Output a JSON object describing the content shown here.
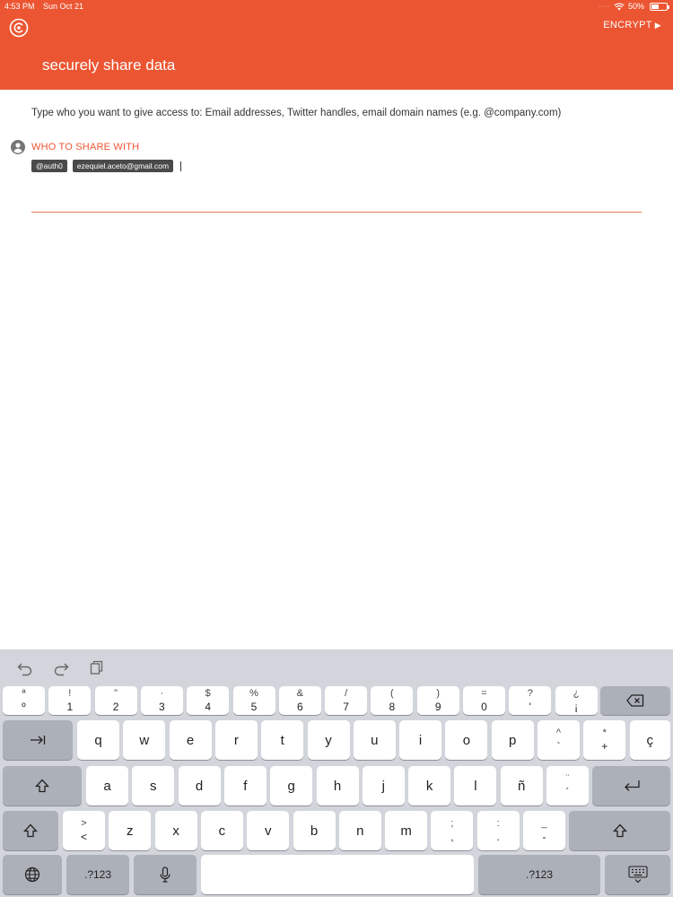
{
  "status_bar": {
    "time": "4:53 PM",
    "date": "Sun Oct 21",
    "battery": "50%",
    "battery_level": 0.5
  },
  "header": {
    "title": "securely share data",
    "encrypt_label": "ENCRYPT",
    "encrypt_arrow": "▶",
    "accent_color": "#ec5532"
  },
  "content": {
    "instructions": "Type who you want to give access to: Email addresses, Twitter handles, email domain names (e.g. @company.com)",
    "field_label": "WHO TO SHARE WITH",
    "chips": [
      "@auth0",
      "ezequiel.aceto@gmail.com"
    ]
  },
  "keyboard": {
    "row1": [
      {
        "top": "ª",
        "bottom": "º"
      },
      {
        "top": "!",
        "bottom": "1"
      },
      {
        "top": "\"",
        "bottom": "2"
      },
      {
        "top": "·",
        "bottom": "3"
      },
      {
        "top": "$",
        "bottom": "4"
      },
      {
        "top": "%",
        "bottom": "5"
      },
      {
        "top": "&",
        "bottom": "6"
      },
      {
        "top": "/",
        "bottom": "7"
      },
      {
        "top": "(",
        "bottom": "8"
      },
      {
        "top": ")",
        "bottom": "9"
      },
      {
        "top": "=",
        "bottom": "0"
      },
      {
        "top": "?",
        "bottom": "'"
      },
      {
        "top": "¿",
        "bottom": "¡"
      }
    ],
    "row2": [
      "q",
      "w",
      "e",
      "r",
      "t",
      "y",
      "u",
      "i",
      "o",
      "p"
    ],
    "row2_extra": [
      {
        "top": "^",
        "bottom": "`"
      },
      {
        "top": "*",
        "bottom": "+"
      },
      {
        "top": "",
        "bottom": "ç"
      }
    ],
    "row3": [
      "a",
      "s",
      "d",
      "f",
      "g",
      "h",
      "j",
      "k",
      "l",
      "ñ"
    ],
    "row3_extra": {
      "top": "¨",
      "bottom": "´"
    },
    "row4_extra_left": {
      "top": ">",
      "bottom": "<"
    },
    "row4": [
      "z",
      "x",
      "c",
      "v",
      "b",
      "n",
      "m"
    ],
    "row4_extra": [
      {
        "top": ";",
        "bottom": ","
      },
      {
        "top": ":",
        "bottom": "."
      },
      {
        "top": "_",
        "bottom": "-"
      }
    ],
    "numbers_label": ".?123",
    "icons": {
      "tab": "tab-icon",
      "shift": "shift-icon",
      "delete": "delete-icon",
      "return": "return-icon",
      "globe": "globe-icon",
      "mic": "microphone-icon",
      "hide": "hide-keyboard-icon",
      "undo": "undo-icon",
      "redo": "redo-icon",
      "paste": "paste-icon"
    }
  }
}
